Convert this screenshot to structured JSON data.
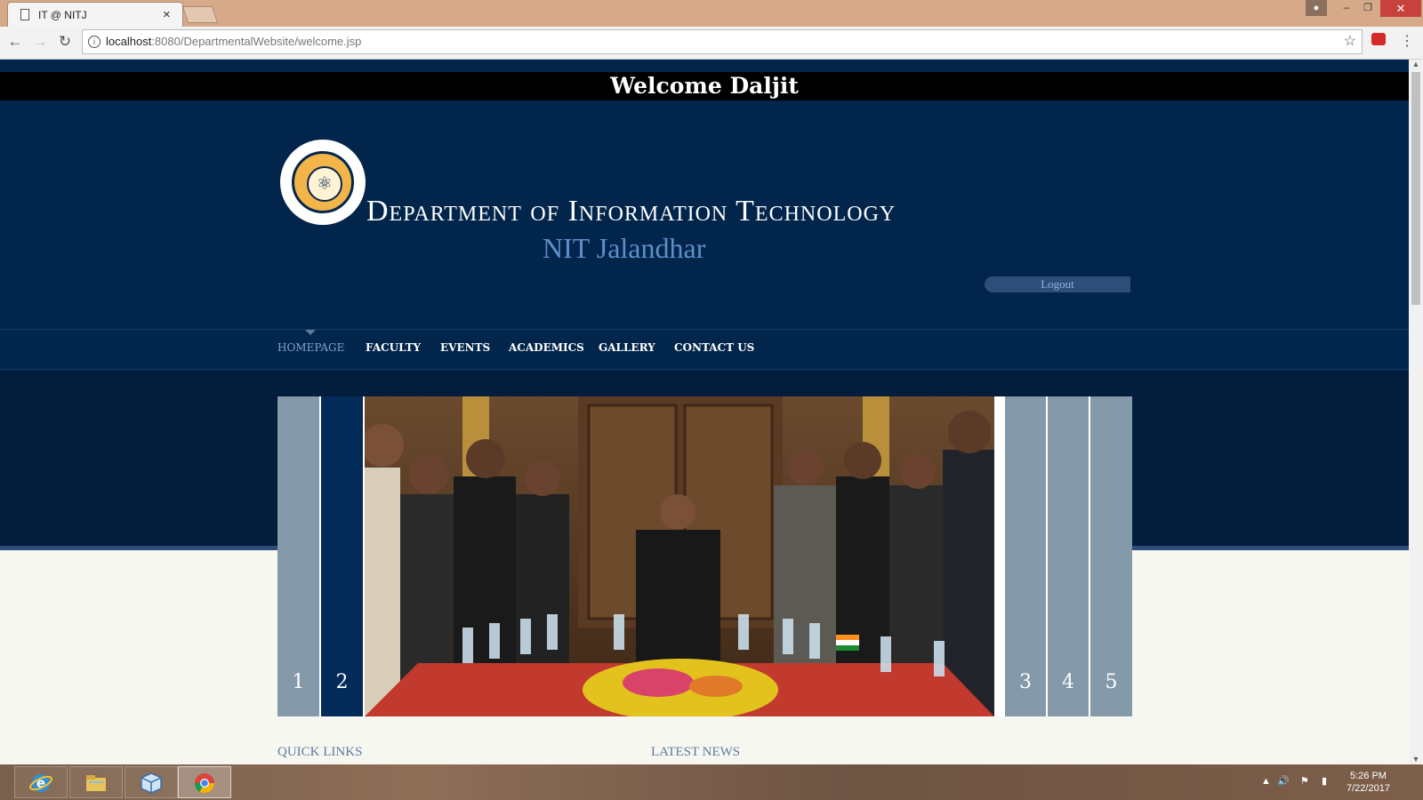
{
  "browser": {
    "tab_title": "IT @ NITJ",
    "tab_close": "×",
    "url_host": "localhost",
    "url_rest": ":8080/DepartmentalWebsite/welcome.jsp",
    "window_controls": {
      "minimize": "–",
      "maximize": "❐",
      "close": "✕"
    },
    "nav_icons": {
      "back": "←",
      "forward": "→",
      "reload": "↻",
      "info": "i",
      "star": "☆",
      "menu": "⋮"
    }
  },
  "page": {
    "welcome": "Welcome Daljit",
    "department_title": "Department of Information Technology",
    "college": "NIT Jalandhar",
    "logout": "Logout",
    "nav": [
      "HOMEPAGE",
      "FACULTY",
      "EVENTS",
      "ACADEMICS",
      "GALLERY",
      "CONTACT US"
    ],
    "active_nav": "HOMEPAGE",
    "slider": {
      "tabs": [
        "1",
        "2",
        "3",
        "4",
        "5"
      ],
      "active_tab": "2"
    },
    "sections": {
      "quick_links": "QUICK LINKS",
      "latest_news": "LATEST NEWS"
    }
  },
  "taskbar": {
    "apps": [
      "internet-explorer-icon",
      "file-explorer-icon",
      "virtualbox-icon",
      "chrome-icon"
    ],
    "active_app": "chrome-icon",
    "time": "5:26 PM",
    "date": "7/22/2017"
  },
  "colors": {
    "header_navy": "#02254b",
    "active_slide_tab": "#022b5a",
    "inactive_slide_tab": "#8499aa",
    "college_blue": "#5e8fc9"
  }
}
